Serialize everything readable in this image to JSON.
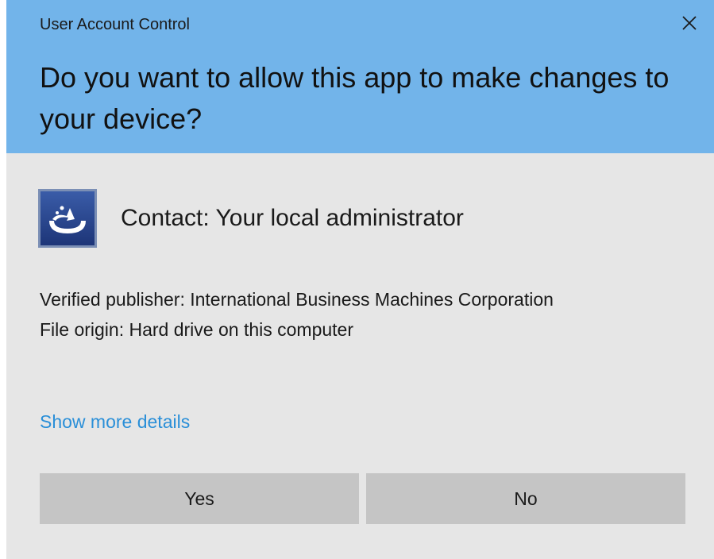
{
  "dialog": {
    "title": "User Account Control",
    "question": "Do you want to allow this app to make changes to your device?",
    "app_name": "Contact:  Your local administrator",
    "app_icon": "ibm-admin-app-icon",
    "details": {
      "publisher": "Verified publisher: International Business Machines Corporation",
      "file_origin": "File origin: Hard drive on this computer"
    },
    "show_more_link": "Show more details",
    "buttons": {
      "yes": "Yes",
      "no": "No"
    },
    "close_icon": "close-icon"
  },
  "colors": {
    "header_bg": "#72b4ea",
    "body_bg": "#e6e6e6",
    "button_bg": "#c5c5c5",
    "link": "#2a8fd8"
  }
}
